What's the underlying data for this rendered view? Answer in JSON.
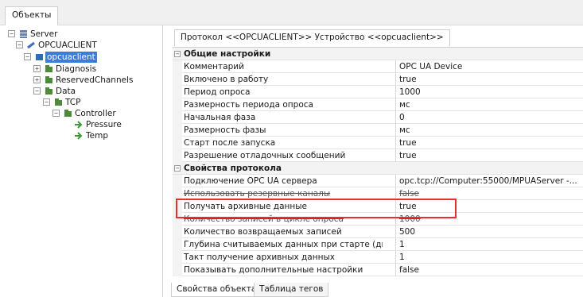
{
  "top_tab": {
    "label": "Объекты"
  },
  "tree": {
    "nodes": [
      {
        "label": "Server"
      },
      {
        "label": "OPCUACLIENT"
      },
      {
        "label": "opcuaclient"
      },
      {
        "label": "Diagnosis"
      },
      {
        "label": "ReservedChannels"
      },
      {
        "label": "Data"
      },
      {
        "label": "TCP"
      },
      {
        "label": "Controller"
      },
      {
        "label": "Pressure"
      },
      {
        "label": "Temp"
      }
    ]
  },
  "protocol_tab": {
    "label": "Протокол <<OPCUACLIENT>> Устройство <<opcuaclient>>"
  },
  "properties": {
    "general_title": "Общие настройки",
    "general": [
      {
        "name": "Комментарий",
        "value": "OPC UA Device"
      },
      {
        "name": "Включено в работу",
        "value": "true"
      },
      {
        "name": "Период опроса",
        "value": "1000"
      },
      {
        "name": "Размерность периода опроса",
        "value": "мс"
      },
      {
        "name": "Начальная фаза",
        "value": "0"
      },
      {
        "name": "Размерность фазы",
        "value": "мс"
      },
      {
        "name": "Старт после запуска",
        "value": "true"
      },
      {
        "name": "Разрешение отладочных сообщений",
        "value": "true"
      }
    ],
    "protocol_title": "Свойства протокола",
    "protocol": [
      {
        "name": "Подключение OPC UA сервера",
        "value": "opc.tcp://Computer:55000/MPUAServer -..."
      },
      {
        "name": "Использовать резервные каналы",
        "value": "false"
      },
      {
        "name": "Получать архивные данные",
        "value": "true"
      },
      {
        "name": "Количество записей в цикле опроса",
        "value": "1000"
      },
      {
        "name": "Количество возвращаемых записей",
        "value": "500"
      },
      {
        "name": "Глубина считываемых данных при старте (дни)",
        "value": "1"
      },
      {
        "name": "Такт получение архивных данных",
        "value": "1"
      },
      {
        "name": "Показывать дополнительные настройки",
        "value": "false"
      }
    ]
  },
  "bottom_tabs": [
    {
      "label": "Свойства объекта"
    },
    {
      "label": "Таблица тегов"
    }
  ],
  "colors": {
    "selection": "#3d7bd9",
    "highlight": "#e53030"
  },
  "icons": [
    "server-icon",
    "folder-icon",
    "device-icon",
    "tag-icon"
  ]
}
